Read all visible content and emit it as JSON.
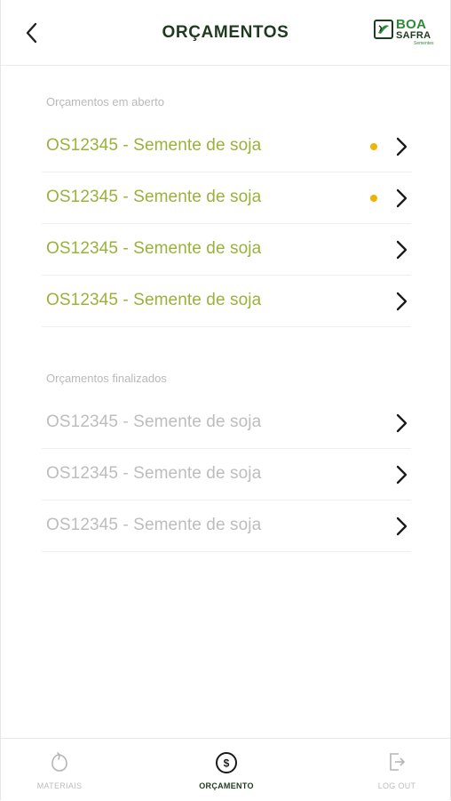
{
  "header": {
    "title": "ORÇAMENTOS",
    "back_icon": "chevron-left-icon",
    "logo": {
      "line1": "BOA",
      "line2": "SAFRA",
      "line3": "Sementes"
    }
  },
  "colors": {
    "open_item": "#9ab13a",
    "done_item": "#bdbdbd",
    "status_dot": "#f0b400",
    "title": "#1f3a1f"
  },
  "sections": {
    "open": {
      "label": "Orçamentos em aberto",
      "items": [
        {
          "label": "OS12345 - Semente de soja",
          "dot": true
        },
        {
          "label": "OS12345 - Semente de soja",
          "dot": true
        },
        {
          "label": "OS12345 - Semente de soja",
          "dot": false
        },
        {
          "label": "OS12345 - Semente de soja",
          "dot": false
        }
      ]
    },
    "done": {
      "label": "Orçamentos finalizados",
      "items": [
        {
          "label": "OS12345 - Semente de soja"
        },
        {
          "label": "OS12345 - Semente de soja"
        },
        {
          "label": "OS12345 - Semente de soja"
        }
      ]
    }
  },
  "tabbar": {
    "items": [
      {
        "label": "MATERIAIS",
        "icon": "seed-icon",
        "active": false
      },
      {
        "label": "ORÇAMENTO",
        "icon": "dollar-circle-icon",
        "active": true
      },
      {
        "label": "LOG OUT",
        "icon": "logout-icon",
        "active": false
      }
    ]
  }
}
